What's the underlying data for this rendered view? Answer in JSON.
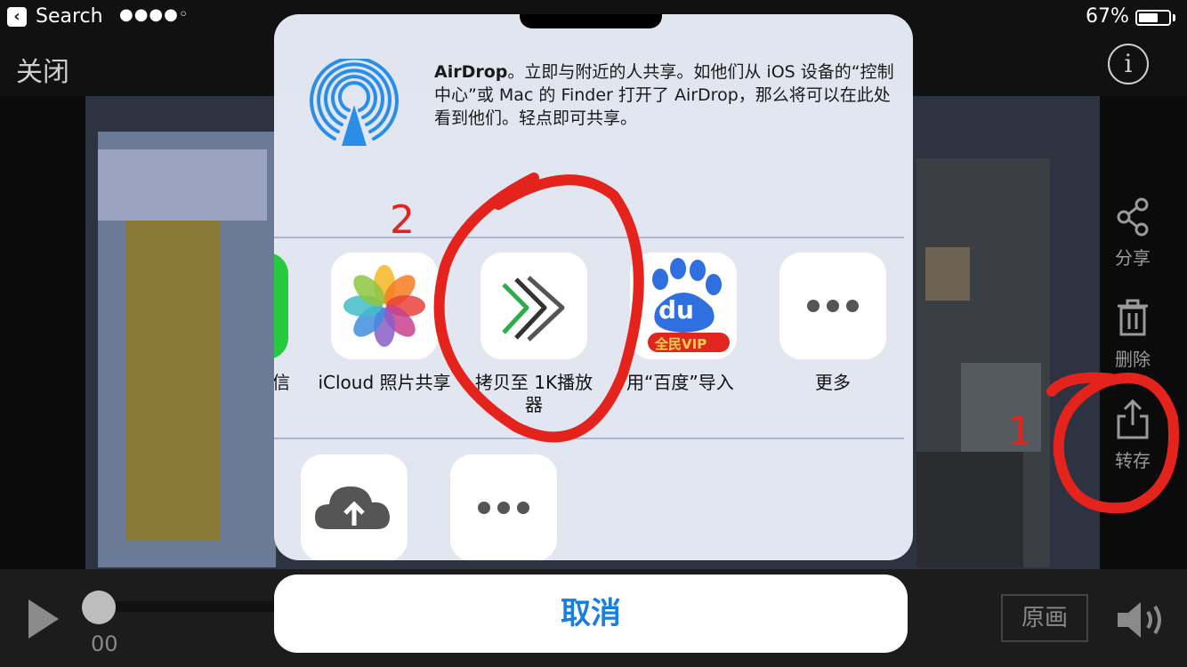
{
  "status_bar": {
    "back_label": "Search",
    "signal": "●●●●◦",
    "battery_percent": "67%",
    "battery_level": 0.67
  },
  "nav": {
    "close_label": "关闭",
    "info_label": "i"
  },
  "tools": [
    {
      "label": "分享",
      "icon": "share-nodes-icon"
    },
    {
      "label": "删除",
      "icon": "trash-icon"
    },
    {
      "label": "转存",
      "icon": "upload-icon"
    }
  ],
  "share_sheet": {
    "airdrop_title": "AirDrop",
    "airdrop_text": "。立即与附近的人共享。如他们从 iOS 设备的“控制中心”或 Mac 的 Finder 打开了 AirDrop，那么将可以在此处看到他们。轻点即可共享。",
    "apps": [
      {
        "label": "信",
        "icon": "messages-icon"
      },
      {
        "label": "iCloud 照片共享",
        "icon": "photos-icon"
      },
      {
        "label": "拷贝至 1K播放器",
        "icon": "1k-player-icon"
      },
      {
        "label": "用“百度”导入",
        "icon": "baidu-icon",
        "badge": "全民VIP",
        "logo": "du"
      },
      {
        "label": "更多",
        "icon": "more-icon"
      }
    ],
    "actions": [
      {
        "icon": "cloud-upload-icon"
      },
      {
        "icon": "more-icon"
      }
    ],
    "cancel_label": "取消"
  },
  "player": {
    "time": "00",
    "quality_label": "原画"
  },
  "annotations": {
    "step1": "1",
    "step2": "2"
  },
  "colors": {
    "cancel_text": "#1a7de0",
    "annotation_red": "#e3231c",
    "airdrop_blue": "#2a8ee6"
  }
}
